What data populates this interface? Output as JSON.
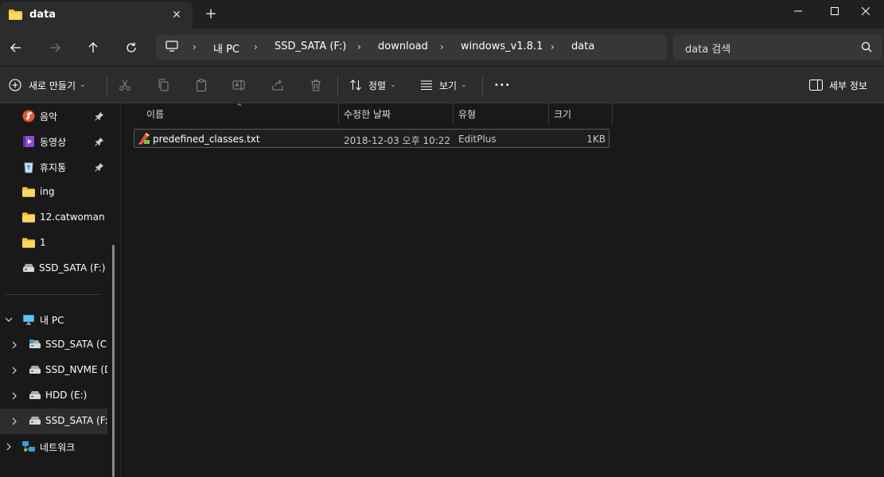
{
  "tab": {
    "title": "data",
    "close": "✕",
    "new": "+"
  },
  "window": {
    "minimize": "─",
    "maximize": "□",
    "close": "✕"
  },
  "address": {
    "crumbs": [
      "내 PC",
      "SSD_SATA (F:)",
      "download",
      "windows_v1.8.1",
      "data"
    ]
  },
  "search": {
    "text": "data 검색"
  },
  "toolbar": {
    "new_label": "새로 만들기",
    "sort_label": "정렬",
    "view_label": "보기",
    "more_label": "•••",
    "details_label": "세부 정보"
  },
  "sidebar": {
    "quick": [
      {
        "label": "음악",
        "icon": "music-icon",
        "pinned": true
      },
      {
        "label": "동영상",
        "icon": "video-icon",
        "pinned": true
      },
      {
        "label": "휴지통",
        "icon": "recycle-bin-icon",
        "pinned": true
      },
      {
        "label": "ing",
        "icon": "folder-icon"
      },
      {
        "label": "12.catwoman",
        "icon": "folder-icon"
      },
      {
        "label": "1",
        "icon": "folder-icon"
      },
      {
        "label": "SSD_SATA (F:)",
        "icon": "drive-icon"
      }
    ],
    "this_pc": {
      "label": "내 PC"
    },
    "drives": [
      {
        "label": "SSD_SATA (C:)"
      },
      {
        "label": "SSD_NVME (D:)"
      },
      {
        "label": "HDD (E:)"
      },
      {
        "label": "SSD_SATA (F:)",
        "selected": true
      }
    ],
    "network": {
      "label": "네트워크"
    }
  },
  "columns": {
    "name": "이름",
    "modified": "수정한 날짜",
    "type": "유형",
    "size": "크기"
  },
  "files": [
    {
      "name": "predefined_classes.txt",
      "modified": "2018-12-03 오후 10:22",
      "type": "EditPlus",
      "size": "1KB"
    }
  ],
  "colors": {
    "folder": "#f3c13a",
    "accent": "#4cc2ff",
    "background": "#191919",
    "chrome": "#2c2c2c"
  }
}
